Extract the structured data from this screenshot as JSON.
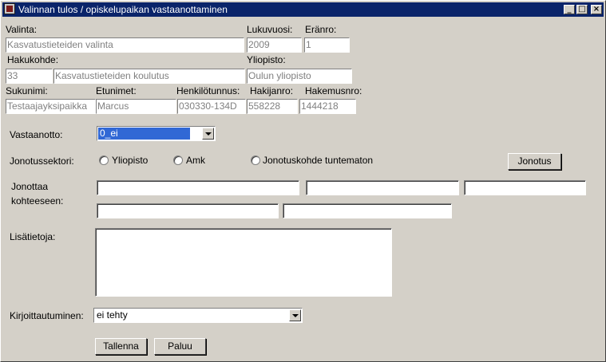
{
  "window": {
    "title": "Valinnan tulos / opiskelupaikan vastaanottaminen",
    "minimize": "_",
    "maximize": "□",
    "close": "×"
  },
  "labels": {
    "valinta": "Valinta:",
    "lukuvuosi": "Lukuvuosi:",
    "eranro": "Eränro:",
    "hakukohde": "Hakukohde:",
    "yliopisto": "Yliopisto:",
    "sukunimi": "Sukunimi:",
    "etunimet": "Etunimet:",
    "henkilotunnus": "Henkilötunnus:",
    "hakijanro": "Hakijanro:",
    "hakemusnro": "Hakemusnro:",
    "vastaanotto": "Vastaanotto:",
    "jonotussektori": "Jonotussektori:",
    "jonottaa_line1": "Jonottaa",
    "jonottaa_line2": "kohteeseen:",
    "lisatietoja": "Lisätietoja:",
    "kirjoittautuminen": "Kirjoittautuminen:"
  },
  "fields": {
    "valinta": "Kasvatustieteiden valinta",
    "lukuvuosi": "2009",
    "eranro": "1",
    "hakukohde_code": "33",
    "hakukohde_name": "Kasvatustieteiden koulutus",
    "yliopisto": "Oulun yliopisto",
    "sukunimi": "Testaajayksipaikka",
    "etunimet": "Marcus",
    "henkilotunnus": "030330-134D",
    "hakijanro": "558228",
    "hakemusnro": "1444218"
  },
  "selects": {
    "vastaanotto": "0_ei",
    "kirjoittautuminen": "ei tehty"
  },
  "radios": {
    "yliopisto": "Yliopisto",
    "amk": "Amk",
    "tuntematon": "Jonotuskohde tuntematon"
  },
  "buttons": {
    "jonotus": "Jonotus",
    "tallenna": "Tallenna",
    "paluu": "Paluu"
  }
}
